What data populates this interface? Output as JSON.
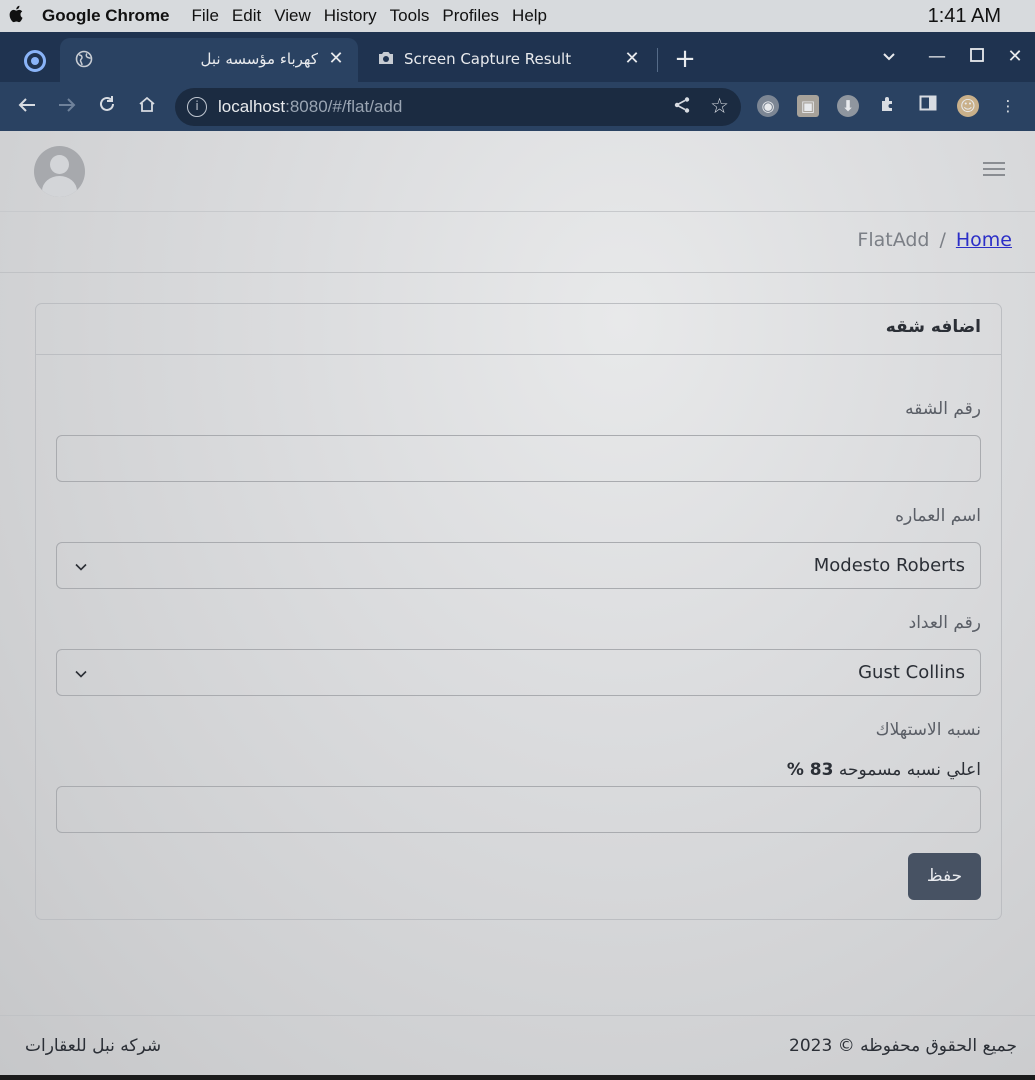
{
  "os_menu": {
    "app_name": "Google Chrome",
    "items": [
      "File",
      "Edit",
      "View",
      "History",
      "Tools",
      "Profiles",
      "Help"
    ],
    "clock": "1:41 AM"
  },
  "browser": {
    "tabs": [
      {
        "title": "كهرباء مؤسسه نبل",
        "active": true
      },
      {
        "title": "Screen Capture Result",
        "active": false
      }
    ],
    "url_host": "localhost",
    "url_path": ":8080/#/flat/add"
  },
  "breadcrumb": {
    "current": "FlatAdd",
    "separator": "/",
    "home": "Home"
  },
  "form": {
    "title": "اضافه شقه",
    "flat_number_label": "رقم الشقه",
    "flat_number_value": "",
    "building_label": "اسم العماره",
    "building_selected": "Modesto Roberts",
    "meter_label": "رقم العداد",
    "meter_selected": "Gust Collins",
    "consumption_label": "نسبه الاستهلاك",
    "max_ratio_prefix": "اعلي نسبه مسموحه",
    "max_ratio_value": "83 %",
    "consumption_value": "",
    "save_label": "حفظ"
  },
  "footer": {
    "rights": "جميع الحقوق محفوظه",
    "copyright_symbol": "©",
    "year": "2023",
    "company": "شركه نبل للعقارات"
  }
}
